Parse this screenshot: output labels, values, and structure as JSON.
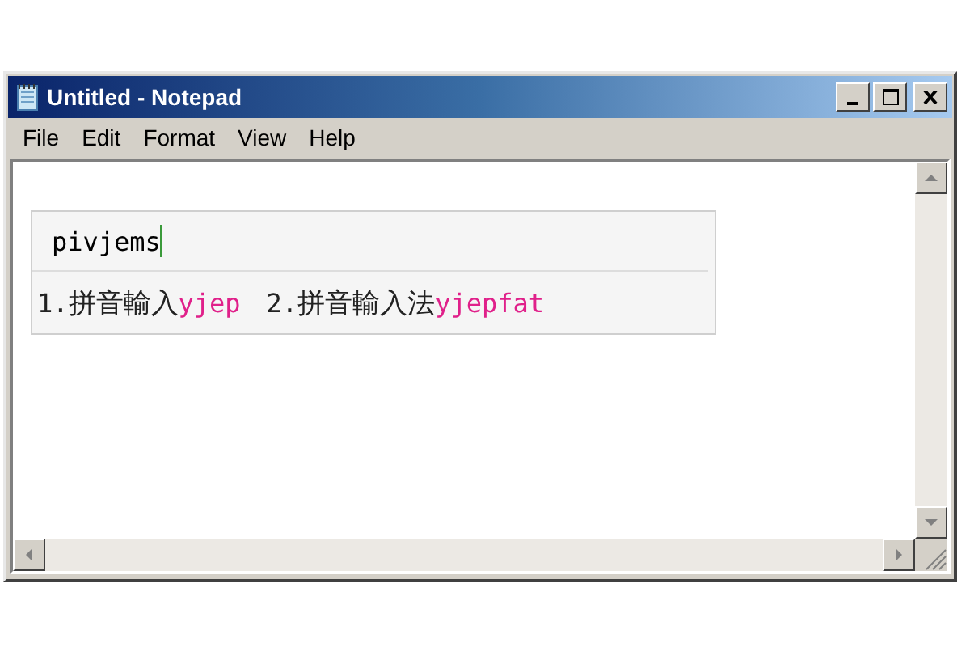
{
  "window": {
    "title": "Untitled - Notepad"
  },
  "menu": [
    "File",
    "Edit",
    "Format",
    "View",
    "Help"
  ],
  "ime": {
    "composition": "pivjems",
    "candidates": [
      {
        "number": "1.",
        "text": "拼音輸入",
        "code": "yjep"
      },
      {
        "number": "2.",
        "text": "拼音輸入法",
        "code": "yjepfat"
      }
    ]
  }
}
